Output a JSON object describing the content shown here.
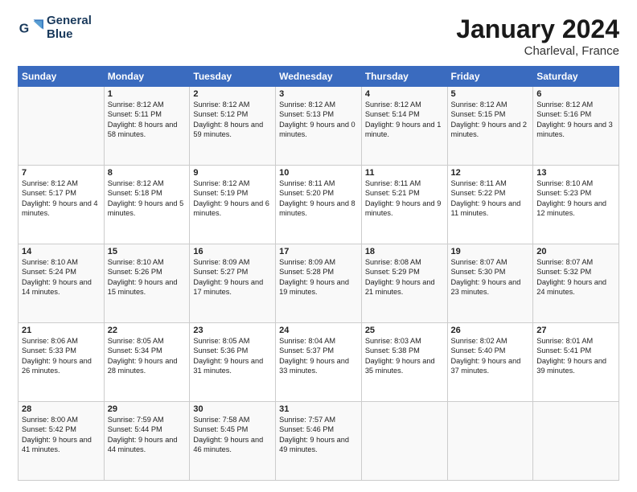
{
  "header": {
    "logo_line1": "General",
    "logo_line2": "Blue",
    "title": "January 2024",
    "subtitle": "Charleval, France"
  },
  "columns": [
    "Sunday",
    "Monday",
    "Tuesday",
    "Wednesday",
    "Thursday",
    "Friday",
    "Saturday"
  ],
  "weeks": [
    [
      {
        "day": "",
        "sunrise": "",
        "sunset": "",
        "daylight": ""
      },
      {
        "day": "1",
        "sunrise": "Sunrise: 8:12 AM",
        "sunset": "Sunset: 5:11 PM",
        "daylight": "Daylight: 8 hours and 58 minutes."
      },
      {
        "day": "2",
        "sunrise": "Sunrise: 8:12 AM",
        "sunset": "Sunset: 5:12 PM",
        "daylight": "Daylight: 8 hours and 59 minutes."
      },
      {
        "day": "3",
        "sunrise": "Sunrise: 8:12 AM",
        "sunset": "Sunset: 5:13 PM",
        "daylight": "Daylight: 9 hours and 0 minutes."
      },
      {
        "day": "4",
        "sunrise": "Sunrise: 8:12 AM",
        "sunset": "Sunset: 5:14 PM",
        "daylight": "Daylight: 9 hours and 1 minute."
      },
      {
        "day": "5",
        "sunrise": "Sunrise: 8:12 AM",
        "sunset": "Sunset: 5:15 PM",
        "daylight": "Daylight: 9 hours and 2 minutes."
      },
      {
        "day": "6",
        "sunrise": "Sunrise: 8:12 AM",
        "sunset": "Sunset: 5:16 PM",
        "daylight": "Daylight: 9 hours and 3 minutes."
      }
    ],
    [
      {
        "day": "7",
        "sunrise": "Sunrise: 8:12 AM",
        "sunset": "Sunset: 5:17 PM",
        "daylight": "Daylight: 9 hours and 4 minutes."
      },
      {
        "day": "8",
        "sunrise": "Sunrise: 8:12 AM",
        "sunset": "Sunset: 5:18 PM",
        "daylight": "Daylight: 9 hours and 5 minutes."
      },
      {
        "day": "9",
        "sunrise": "Sunrise: 8:12 AM",
        "sunset": "Sunset: 5:19 PM",
        "daylight": "Daylight: 9 hours and 6 minutes."
      },
      {
        "day": "10",
        "sunrise": "Sunrise: 8:11 AM",
        "sunset": "Sunset: 5:20 PM",
        "daylight": "Daylight: 9 hours and 8 minutes."
      },
      {
        "day": "11",
        "sunrise": "Sunrise: 8:11 AM",
        "sunset": "Sunset: 5:21 PM",
        "daylight": "Daylight: 9 hours and 9 minutes."
      },
      {
        "day": "12",
        "sunrise": "Sunrise: 8:11 AM",
        "sunset": "Sunset: 5:22 PM",
        "daylight": "Daylight: 9 hours and 11 minutes."
      },
      {
        "day": "13",
        "sunrise": "Sunrise: 8:10 AM",
        "sunset": "Sunset: 5:23 PM",
        "daylight": "Daylight: 9 hours and 12 minutes."
      }
    ],
    [
      {
        "day": "14",
        "sunrise": "Sunrise: 8:10 AM",
        "sunset": "Sunset: 5:24 PM",
        "daylight": "Daylight: 9 hours and 14 minutes."
      },
      {
        "day": "15",
        "sunrise": "Sunrise: 8:10 AM",
        "sunset": "Sunset: 5:26 PM",
        "daylight": "Daylight: 9 hours and 15 minutes."
      },
      {
        "day": "16",
        "sunrise": "Sunrise: 8:09 AM",
        "sunset": "Sunset: 5:27 PM",
        "daylight": "Daylight: 9 hours and 17 minutes."
      },
      {
        "day": "17",
        "sunrise": "Sunrise: 8:09 AM",
        "sunset": "Sunset: 5:28 PM",
        "daylight": "Daylight: 9 hours and 19 minutes."
      },
      {
        "day": "18",
        "sunrise": "Sunrise: 8:08 AM",
        "sunset": "Sunset: 5:29 PM",
        "daylight": "Daylight: 9 hours and 21 minutes."
      },
      {
        "day": "19",
        "sunrise": "Sunrise: 8:07 AM",
        "sunset": "Sunset: 5:30 PM",
        "daylight": "Daylight: 9 hours and 23 minutes."
      },
      {
        "day": "20",
        "sunrise": "Sunrise: 8:07 AM",
        "sunset": "Sunset: 5:32 PM",
        "daylight": "Daylight: 9 hours and 24 minutes."
      }
    ],
    [
      {
        "day": "21",
        "sunrise": "Sunrise: 8:06 AM",
        "sunset": "Sunset: 5:33 PM",
        "daylight": "Daylight: 9 hours and 26 minutes."
      },
      {
        "day": "22",
        "sunrise": "Sunrise: 8:05 AM",
        "sunset": "Sunset: 5:34 PM",
        "daylight": "Daylight: 9 hours and 28 minutes."
      },
      {
        "day": "23",
        "sunrise": "Sunrise: 8:05 AM",
        "sunset": "Sunset: 5:36 PM",
        "daylight": "Daylight: 9 hours and 31 minutes."
      },
      {
        "day": "24",
        "sunrise": "Sunrise: 8:04 AM",
        "sunset": "Sunset: 5:37 PM",
        "daylight": "Daylight: 9 hours and 33 minutes."
      },
      {
        "day": "25",
        "sunrise": "Sunrise: 8:03 AM",
        "sunset": "Sunset: 5:38 PM",
        "daylight": "Daylight: 9 hours and 35 minutes."
      },
      {
        "day": "26",
        "sunrise": "Sunrise: 8:02 AM",
        "sunset": "Sunset: 5:40 PM",
        "daylight": "Daylight: 9 hours and 37 minutes."
      },
      {
        "day": "27",
        "sunrise": "Sunrise: 8:01 AM",
        "sunset": "Sunset: 5:41 PM",
        "daylight": "Daylight: 9 hours and 39 minutes."
      }
    ],
    [
      {
        "day": "28",
        "sunrise": "Sunrise: 8:00 AM",
        "sunset": "Sunset: 5:42 PM",
        "daylight": "Daylight: 9 hours and 41 minutes."
      },
      {
        "day": "29",
        "sunrise": "Sunrise: 7:59 AM",
        "sunset": "Sunset: 5:44 PM",
        "daylight": "Daylight: 9 hours and 44 minutes."
      },
      {
        "day": "30",
        "sunrise": "Sunrise: 7:58 AM",
        "sunset": "Sunset: 5:45 PM",
        "daylight": "Daylight: 9 hours and 46 minutes."
      },
      {
        "day": "31",
        "sunrise": "Sunrise: 7:57 AM",
        "sunset": "Sunset: 5:46 PM",
        "daylight": "Daylight: 9 hours and 49 minutes."
      },
      {
        "day": "",
        "sunrise": "",
        "sunset": "",
        "daylight": ""
      },
      {
        "day": "",
        "sunrise": "",
        "sunset": "",
        "daylight": ""
      },
      {
        "day": "",
        "sunrise": "",
        "sunset": "",
        "daylight": ""
      }
    ]
  ]
}
